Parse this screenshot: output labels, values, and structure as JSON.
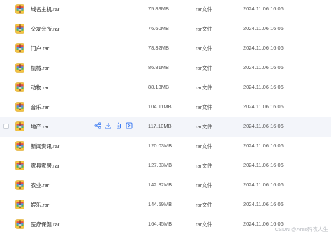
{
  "files": [
    {
      "name": "域名主机.rar",
      "size": "75.89MB",
      "type": "rar文件",
      "date": "2024.11.06 16:06"
    },
    {
      "name": "交友会所.rar",
      "size": "76.60MB",
      "type": "rar文件",
      "date": "2024.11.06 16:06"
    },
    {
      "name": "门户.rar",
      "size": "78.32MB",
      "type": "rar文件",
      "date": "2024.11.06 16:06"
    },
    {
      "name": "机械.rar",
      "size": "86.81MB",
      "type": "rar文件",
      "date": "2024.11.06 16:06"
    },
    {
      "name": "动物.rar",
      "size": "88.13MB",
      "type": "rar文件",
      "date": "2024.11.06 16:06"
    },
    {
      "name": "音乐.rar",
      "size": "104.11MB",
      "type": "rar文件",
      "date": "2024.11.06 16:06"
    },
    {
      "name": "地产.rar",
      "size": "117.10MB",
      "type": "rar文件",
      "date": "2024.11.06 16:06",
      "hovered": true
    },
    {
      "name": "新闻资讯.rar",
      "size": "120.03MB",
      "type": "rar文件",
      "date": "2024.11.06 16:06"
    },
    {
      "name": "家具家居.rar",
      "size": "127.83MB",
      "type": "rar文件",
      "date": "2024.11.06 16:06"
    },
    {
      "name": "农业.rar",
      "size": "142.82MB",
      "type": "rar文件",
      "date": "2024.11.06 16:06"
    },
    {
      "name": "娱乐.rar",
      "size": "144.59MB",
      "type": "rar文件",
      "date": "2024.11.06 16:06"
    },
    {
      "name": "医疗保健.rar",
      "size": "164.45MB",
      "type": "rar文件",
      "date": "2024.11.06 16:06"
    }
  ],
  "row_actions": [
    "share-icon",
    "download-icon",
    "delete-icon",
    "more-icon"
  ],
  "colors": {
    "hover_row": "#f3f5fa",
    "action_icon": "#3d7cf2"
  },
  "watermark": "CSDN @Ares码农人生"
}
